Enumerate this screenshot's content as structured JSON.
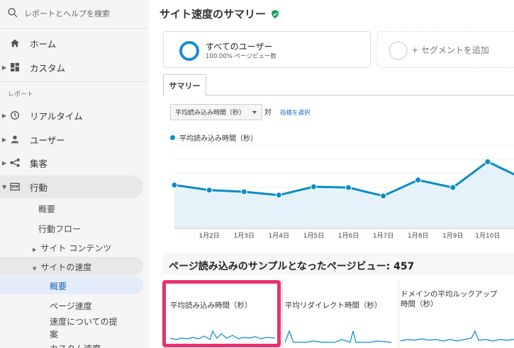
{
  "sidebar": {
    "search_placeholder": "レポートとヘルプを検索",
    "home": "ホーム",
    "custom": "カスタム",
    "section_report": "レポート",
    "realtime": "リアルタイム",
    "users": "ユーザー",
    "acquisition": "集客",
    "behavior": "行動",
    "behavior_sub": {
      "overview": "概要",
      "flow": "行動フロー",
      "site_content": "サイト コンテンツ",
      "site_speed": "サイトの速度",
      "speed_overview": "概要",
      "page_timings": "ページ速度",
      "speed_suggestions_line1": "速度についての提",
      "speed_suggestions_line2": "案",
      "custom_speed": "カスタム速度"
    }
  },
  "main": {
    "title": "サイト速度のサマリー",
    "segment": {
      "name": "すべてのユーザー",
      "sub": "100.00% ページビュー数"
    },
    "add_segment": "+ セグメントを追加",
    "tab_summary": "サマリー",
    "metric_select": "平均読み込み時間（秒）",
    "vs_label": "対",
    "pick_metric": "指標を選択",
    "legend_label": "平均読み込み時間（秒）",
    "sample_title": "ページ読み込みのサンプルとなったページビュー: 457",
    "cards": [
      {
        "label": "平均読み込み時間（秒）"
      },
      {
        "label": "平均リダイレクト時間（秒）"
      },
      {
        "label_line1": "ドメインの平均ルックアップ",
        "label_line2": "時間（秒）"
      }
    ]
  },
  "colors": {
    "accent": "#058dc7",
    "segment_ring": "#1a8ad4",
    "highlight_box": "#e8316e",
    "verified": "#0f9d58"
  },
  "chart_data": {
    "type": "area",
    "series": [
      {
        "name": "平均読み込み時間（秒）",
        "values": [
          0.52,
          0.46,
          0.44,
          0.4,
          0.5,
          0.49,
          0.39,
          0.58,
          0.49,
          0.8,
          0.6
        ]
      }
    ],
    "categories": [
      "",
      "1月2日",
      "1月3日",
      "1月4日",
      "1月5日",
      "1月6日",
      "1月7日",
      "1月8日",
      "1月9日",
      "1月10日",
      ""
    ],
    "ylim": [
      0,
      1
    ],
    "grid": true
  }
}
